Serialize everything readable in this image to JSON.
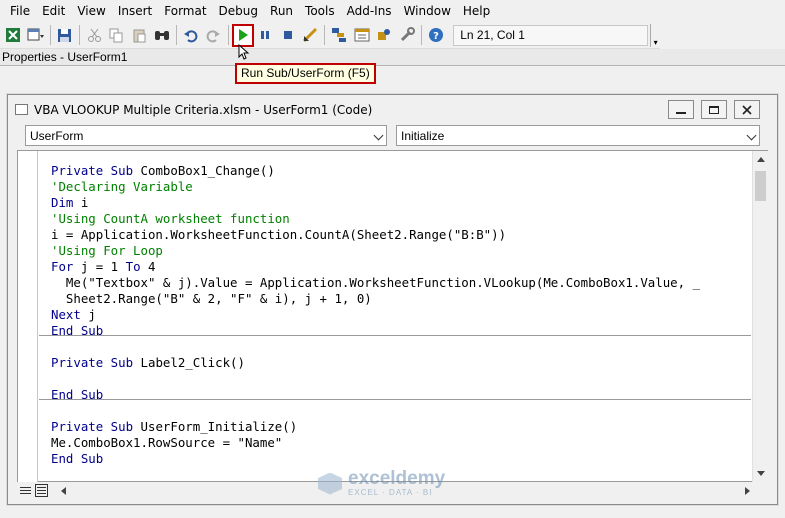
{
  "menu": [
    "File",
    "Edit",
    "View",
    "Insert",
    "Format",
    "Debug",
    "Run",
    "Tools",
    "Add-Ins",
    "Window",
    "Help"
  ],
  "toolbar": {
    "position": "Ln 21, Col 1",
    "run_tooltip": "Run Sub/UserForm (F5)",
    "run_color": "#19a319",
    "highlight_color": "#c00000"
  },
  "properties_title": "Properties - UserForm1",
  "code_window": {
    "title": "VBA VLOOKUP Multiple Criteria.xlsm - UserForm1 (Code)",
    "object_combo": "UserForm",
    "procedure_combo": "Initialize"
  },
  "code": [
    [
      "kw:Private Sub ",
      "tx:ComboBox1_Change()"
    ],
    [
      "cm:'Declaring Variable"
    ],
    [
      "kw:Dim ",
      "tx:i"
    ],
    [
      "cm:'Using CountA worksheet function"
    ],
    [
      "tx:i = Application.WorksheetFunction.CountA(Sheet2.Range(\"B:B\"))"
    ],
    [
      "cm:'Using For Loop"
    ],
    [
      "kw:For ",
      "tx:j = 1 ",
      "kw:To ",
      "tx:4"
    ],
    [
      "tx:  Me(\"Textbox\" & j).Value = Application.WorksheetFunction.VLookup(Me.ComboBox1.Value, _"
    ],
    [
      "tx:  Sheet2.Range(\"B\" & 2, \"F\" & i), j + 1, 0)"
    ],
    [
      "kw:Next ",
      "tx:j"
    ],
    [
      "kw:End Sub"
    ],
    [
      "tx:"
    ],
    [
      "kw:Private Sub ",
      "tx:Label2_Click()"
    ],
    [
      "tx:"
    ],
    [
      "kw:End Sub"
    ],
    [
      "tx:"
    ],
    [
      "kw:Private Sub ",
      "tx:UserForm_Initialize()"
    ],
    [
      "tx:Me.ComboBox1.RowSource = \"Name\""
    ],
    [
      "kw:End Sub"
    ]
  ],
  "icons": [
    "excel-icon",
    "insert-userform-icon",
    "save-icon",
    "cut-icon",
    "copy-icon",
    "paste-icon",
    "find-icon",
    "undo-icon",
    "redo-icon",
    "run-icon",
    "break-icon",
    "reset-icon",
    "design-mode-icon",
    "project-explorer-icon",
    "properties-window-icon",
    "object-browser-icon",
    "toolbox-icon",
    "help-icon"
  ],
  "watermark": {
    "name": "exceldemy",
    "tagline": "EXCEL · DATA · BI"
  }
}
